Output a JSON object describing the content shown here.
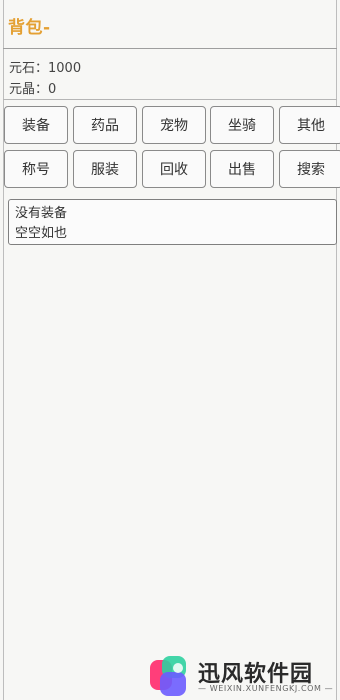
{
  "header": {
    "title": "背包-"
  },
  "stats": {
    "yuanshi": "元石：1000",
    "yuanjing": "元晶：0"
  },
  "tabs_row1": [
    "装备",
    "药品",
    "宠物",
    "坐骑",
    "其他"
  ],
  "tabs_row2": [
    "称号",
    "服装",
    "回收",
    "出售",
    "搜索"
  ],
  "content": {
    "empty_line1": "没有装备",
    "empty_line2": "空空如也"
  },
  "watermark": {
    "brand": "迅风软件园",
    "url": "— WEIXIN.XUNFENGKJ.COM —",
    "colors": {
      "pink": "#ff3e7a",
      "green": "#2fd0a0",
      "purple": "#6b5cff"
    }
  },
  "colors": {
    "title": "#e4a033",
    "background": "#f7f7f5",
    "border": "#8a8a8a"
  }
}
